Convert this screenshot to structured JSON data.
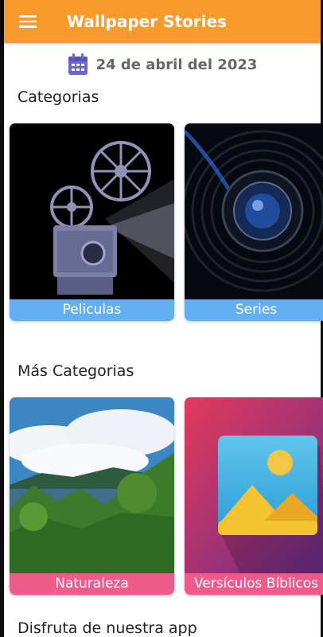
{
  "appbar": {
    "title": "Wallpaper Stories",
    "menu_icon": "hamburger-menu-icon",
    "color": "#f89a2c"
  },
  "date": {
    "icon": "calendar-icon",
    "text": "24 de abril del 2023"
  },
  "sections": {
    "categories": {
      "title": "Categorias",
      "cards": [
        {
          "label": "Peliculas",
          "image": "film-projector-image"
        },
        {
          "label": "Series",
          "image": "camera-lens-image"
        }
      ]
    },
    "more": {
      "title": "Más Categorias",
      "cards": [
        {
          "label": "Naturaleza",
          "image": "nature-landscape-image"
        },
        {
          "label": "Versículos Bíblicos",
          "image": "gallery-image-icon"
        }
      ]
    },
    "enjoy": {
      "title": "Disfruta de nuestra app"
    }
  },
  "colors": {
    "label_blue": "#64aef2",
    "label_pink": "#ef5b8a"
  }
}
